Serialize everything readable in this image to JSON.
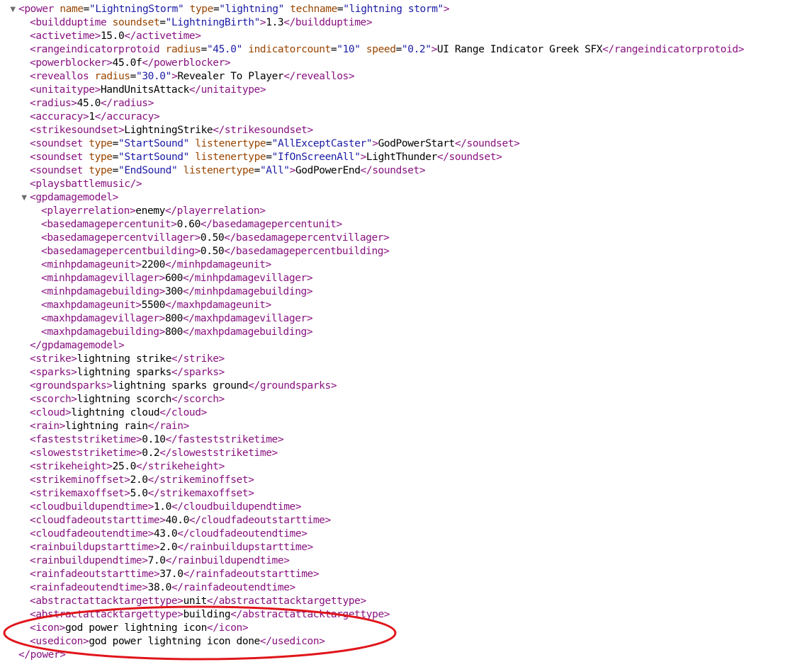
{
  "xml_lines": [
    {
      "depth": 0,
      "toggle": true,
      "segments": [
        [
          "tag",
          "<power"
        ],
        [
          "txt",
          " "
        ],
        [
          "attr",
          "name"
        ],
        [
          "txt",
          "="
        ],
        [
          "val",
          "\"LightningStorm\""
        ],
        [
          "txt",
          " "
        ],
        [
          "attr",
          "type"
        ],
        [
          "txt",
          "="
        ],
        [
          "val",
          "\"lightning\""
        ],
        [
          "txt",
          " "
        ],
        [
          "attr",
          "techname"
        ],
        [
          "txt",
          "="
        ],
        [
          "val",
          "\"lightning storm\""
        ],
        [
          "tag",
          ">"
        ]
      ]
    },
    {
      "depth": 1,
      "segments": [
        [
          "tag",
          "<buildduptime"
        ],
        [
          "txt",
          " "
        ],
        [
          "attr",
          "soundset"
        ],
        [
          "txt",
          "="
        ],
        [
          "val",
          "\"LightningBirth\""
        ],
        [
          "tag",
          ">"
        ],
        [
          "txt",
          "1.3"
        ],
        [
          "tag",
          "</buildduptime>"
        ]
      ]
    },
    {
      "depth": 1,
      "segments": [
        [
          "tag",
          "<activetime>"
        ],
        [
          "txt",
          "15.0"
        ],
        [
          "tag",
          "</activetime>"
        ]
      ]
    },
    {
      "depth": 1,
      "segments": [
        [
          "tag",
          "<rangeindicatorprotoid"
        ],
        [
          "txt",
          " "
        ],
        [
          "attr",
          "radius"
        ],
        [
          "txt",
          "="
        ],
        [
          "val",
          "\"45.0\""
        ],
        [
          "txt",
          " "
        ],
        [
          "attr",
          "indicatorcount"
        ],
        [
          "txt",
          "="
        ],
        [
          "val",
          "\"10\""
        ],
        [
          "txt",
          " "
        ],
        [
          "attr",
          "speed"
        ],
        [
          "txt",
          "="
        ],
        [
          "val",
          "\"0.2\""
        ],
        [
          "tag",
          ">"
        ],
        [
          "txt",
          "UI Range Indicator Greek SFX"
        ],
        [
          "tag",
          "</rangeindicatorprotoid>"
        ]
      ]
    },
    {
      "depth": 1,
      "segments": [
        [
          "tag",
          "<powerblocker>"
        ],
        [
          "txt",
          "45.0f"
        ],
        [
          "tag",
          "</powerblocker>"
        ]
      ]
    },
    {
      "depth": 1,
      "segments": [
        [
          "tag",
          "<reveallos"
        ],
        [
          "txt",
          " "
        ],
        [
          "attr",
          "radius"
        ],
        [
          "txt",
          "="
        ],
        [
          "val",
          "\"30.0\""
        ],
        [
          "tag",
          ">"
        ],
        [
          "txt",
          "Revealer To Player"
        ],
        [
          "tag",
          "</reveallos>"
        ]
      ]
    },
    {
      "depth": 1,
      "segments": [
        [
          "tag",
          "<unitaitype>"
        ],
        [
          "txt",
          "HandUnitsAttack"
        ],
        [
          "tag",
          "</unitaitype>"
        ]
      ]
    },
    {
      "depth": 1,
      "segments": [
        [
          "tag",
          "<radius>"
        ],
        [
          "txt",
          "45.0"
        ],
        [
          "tag",
          "</radius>"
        ]
      ]
    },
    {
      "depth": 1,
      "segments": [
        [
          "tag",
          "<accuracy>"
        ],
        [
          "txt",
          "1"
        ],
        [
          "tag",
          "</accuracy>"
        ]
      ]
    },
    {
      "depth": 1,
      "segments": [
        [
          "tag",
          "<strikesoundset>"
        ],
        [
          "txt",
          "LightningStrike"
        ],
        [
          "tag",
          "</strikesoundset>"
        ]
      ]
    },
    {
      "depth": 1,
      "segments": [
        [
          "tag",
          "<soundset"
        ],
        [
          "txt",
          " "
        ],
        [
          "attr",
          "type"
        ],
        [
          "txt",
          "="
        ],
        [
          "val",
          "\"StartSound\""
        ],
        [
          "txt",
          " "
        ],
        [
          "attr",
          "listenertype"
        ],
        [
          "txt",
          "="
        ],
        [
          "val",
          "\"AllExceptCaster\""
        ],
        [
          "tag",
          ">"
        ],
        [
          "txt",
          "GodPowerStart"
        ],
        [
          "tag",
          "</soundset>"
        ]
      ]
    },
    {
      "depth": 1,
      "segments": [
        [
          "tag",
          "<soundset"
        ],
        [
          "txt",
          " "
        ],
        [
          "attr",
          "type"
        ],
        [
          "txt",
          "="
        ],
        [
          "val",
          "\"StartSound\""
        ],
        [
          "txt",
          " "
        ],
        [
          "attr",
          "listenertype"
        ],
        [
          "txt",
          "="
        ],
        [
          "val",
          "\"IfOnScreenAll\""
        ],
        [
          "tag",
          ">"
        ],
        [
          "txt",
          "LightThunder"
        ],
        [
          "tag",
          "</soundset>"
        ]
      ]
    },
    {
      "depth": 1,
      "segments": [
        [
          "tag",
          "<soundset"
        ],
        [
          "txt",
          " "
        ],
        [
          "attr",
          "type"
        ],
        [
          "txt",
          "="
        ],
        [
          "val",
          "\"EndSound\""
        ],
        [
          "txt",
          " "
        ],
        [
          "attr",
          "listenertype"
        ],
        [
          "txt",
          "="
        ],
        [
          "val",
          "\"All\""
        ],
        [
          "tag",
          ">"
        ],
        [
          "txt",
          "GodPowerEnd"
        ],
        [
          "tag",
          "</soundset>"
        ]
      ]
    },
    {
      "depth": 1,
      "segments": [
        [
          "tag",
          "<playsbattlemusic/>"
        ]
      ]
    },
    {
      "depth": 1,
      "toggle": true,
      "segments": [
        [
          "tag",
          "<gpdamagemodel>"
        ]
      ]
    },
    {
      "depth": 2,
      "segments": [
        [
          "tag",
          "<playerrelation>"
        ],
        [
          "txt",
          "enemy"
        ],
        [
          "tag",
          "</playerrelation>"
        ]
      ]
    },
    {
      "depth": 2,
      "segments": [
        [
          "tag",
          "<basedamagepercentunit>"
        ],
        [
          "txt",
          "0.60"
        ],
        [
          "tag",
          "</basedamagepercentunit>"
        ]
      ]
    },
    {
      "depth": 2,
      "segments": [
        [
          "tag",
          "<basedamagepercentvillager>"
        ],
        [
          "txt",
          "0.50"
        ],
        [
          "tag",
          "</basedamagepercentvillager>"
        ]
      ]
    },
    {
      "depth": 2,
      "segments": [
        [
          "tag",
          "<basedamagepercentbuilding>"
        ],
        [
          "txt",
          "0.50"
        ],
        [
          "tag",
          "</basedamagepercentbuilding>"
        ]
      ]
    },
    {
      "depth": 2,
      "segments": [
        [
          "tag",
          "<minhpdamageunit>"
        ],
        [
          "txt",
          "2200"
        ],
        [
          "tag",
          "</minhpdamageunit>"
        ]
      ]
    },
    {
      "depth": 2,
      "segments": [
        [
          "tag",
          "<minhpdamagevillager>"
        ],
        [
          "txt",
          "600"
        ],
        [
          "tag",
          "</minhpdamagevillager>"
        ]
      ]
    },
    {
      "depth": 2,
      "segments": [
        [
          "tag",
          "<minhpdamagebuilding>"
        ],
        [
          "txt",
          "300"
        ],
        [
          "tag",
          "</minhpdamagebuilding>"
        ]
      ]
    },
    {
      "depth": 2,
      "segments": [
        [
          "tag",
          "<maxhpdamageunit>"
        ],
        [
          "txt",
          "5500"
        ],
        [
          "tag",
          "</maxhpdamageunit>"
        ]
      ]
    },
    {
      "depth": 2,
      "segments": [
        [
          "tag",
          "<maxhpdamagevillager>"
        ],
        [
          "txt",
          "800"
        ],
        [
          "tag",
          "</maxhpdamagevillager>"
        ]
      ]
    },
    {
      "depth": 2,
      "segments": [
        [
          "tag",
          "<maxhpdamagebuilding>"
        ],
        [
          "txt",
          "800"
        ],
        [
          "tag",
          "</maxhpdamagebuilding>"
        ]
      ]
    },
    {
      "depth": 1,
      "segments": [
        [
          "tag",
          "</gpdamagemodel>"
        ]
      ]
    },
    {
      "depth": 1,
      "segments": [
        [
          "tag",
          "<strike>"
        ],
        [
          "txt",
          "lightning strike"
        ],
        [
          "tag",
          "</strike>"
        ]
      ]
    },
    {
      "depth": 1,
      "segments": [
        [
          "tag",
          "<sparks>"
        ],
        [
          "txt",
          "lightning sparks"
        ],
        [
          "tag",
          "</sparks>"
        ]
      ]
    },
    {
      "depth": 1,
      "segments": [
        [
          "tag",
          "<groundsparks>"
        ],
        [
          "txt",
          "lightning sparks ground"
        ],
        [
          "tag",
          "</groundsparks>"
        ]
      ]
    },
    {
      "depth": 1,
      "segments": [
        [
          "tag",
          "<scorch>"
        ],
        [
          "txt",
          "lightning scorch"
        ],
        [
          "tag",
          "</scorch>"
        ]
      ]
    },
    {
      "depth": 1,
      "segments": [
        [
          "tag",
          "<cloud>"
        ],
        [
          "txt",
          "lightning cloud"
        ],
        [
          "tag",
          "</cloud>"
        ]
      ]
    },
    {
      "depth": 1,
      "segments": [
        [
          "tag",
          "<rain>"
        ],
        [
          "txt",
          "lightning rain"
        ],
        [
          "tag",
          "</rain>"
        ]
      ]
    },
    {
      "depth": 1,
      "segments": [
        [
          "tag",
          "<fasteststriketime>"
        ],
        [
          "txt",
          "0.10"
        ],
        [
          "tag",
          "</fasteststriketime>"
        ]
      ]
    },
    {
      "depth": 1,
      "segments": [
        [
          "tag",
          "<sloweststriketime>"
        ],
        [
          "txt",
          "0.2"
        ],
        [
          "tag",
          "</sloweststriketime>"
        ]
      ]
    },
    {
      "depth": 1,
      "segments": [
        [
          "tag",
          "<strikeheight>"
        ],
        [
          "txt",
          "25.0"
        ],
        [
          "tag",
          "</strikeheight>"
        ]
      ]
    },
    {
      "depth": 1,
      "segments": [
        [
          "tag",
          "<strikeminoffset>"
        ],
        [
          "txt",
          "2.0"
        ],
        [
          "tag",
          "</strikeminoffset>"
        ]
      ]
    },
    {
      "depth": 1,
      "segments": [
        [
          "tag",
          "<strikemaxoffset>"
        ],
        [
          "txt",
          "5.0"
        ],
        [
          "tag",
          "</strikemaxoffset>"
        ]
      ]
    },
    {
      "depth": 1,
      "segments": [
        [
          "tag",
          "<cloudbuildupendtime>"
        ],
        [
          "txt",
          "1.0"
        ],
        [
          "tag",
          "</cloudbuildupendtime>"
        ]
      ]
    },
    {
      "depth": 1,
      "segments": [
        [
          "tag",
          "<cloudfadeoutstarttime>"
        ],
        [
          "txt",
          "40.0"
        ],
        [
          "tag",
          "</cloudfadeoutstarttime>"
        ]
      ]
    },
    {
      "depth": 1,
      "segments": [
        [
          "tag",
          "<cloudfadeoutendtime>"
        ],
        [
          "txt",
          "43.0"
        ],
        [
          "tag",
          "</cloudfadeoutendtime>"
        ]
      ]
    },
    {
      "depth": 1,
      "segments": [
        [
          "tag",
          "<rainbuildupstarttime>"
        ],
        [
          "txt",
          "2.0"
        ],
        [
          "tag",
          "</rainbuildupstarttime>"
        ]
      ]
    },
    {
      "depth": 1,
      "segments": [
        [
          "tag",
          "<rainbuildupendtime>"
        ],
        [
          "txt",
          "7.0"
        ],
        [
          "tag",
          "</rainbuildupendtime>"
        ]
      ]
    },
    {
      "depth": 1,
      "segments": [
        [
          "tag",
          "<rainfadeoutstarttime>"
        ],
        [
          "txt",
          "37.0"
        ],
        [
          "tag",
          "</rainfadeoutstarttime>"
        ]
      ]
    },
    {
      "depth": 1,
      "segments": [
        [
          "tag",
          "<rainfadeoutendtime>"
        ],
        [
          "txt",
          "38.0"
        ],
        [
          "tag",
          "</rainfadeoutendtime>"
        ]
      ]
    },
    {
      "depth": 1,
      "segments": [
        [
          "tag",
          "<abstractattacktargettype>"
        ],
        [
          "txt",
          "unit"
        ],
        [
          "tag",
          "</abstractattacktargettype>"
        ]
      ]
    },
    {
      "depth": 1,
      "segments": [
        [
          "tag",
          "<abstractattacktargettype>"
        ],
        [
          "txt",
          "building"
        ],
        [
          "tag",
          "</abstractattacktargettype>"
        ]
      ]
    },
    {
      "depth": 1,
      "segments": [
        [
          "tag",
          "<icon>"
        ],
        [
          "txt",
          "god power lightning icon"
        ],
        [
          "tag",
          "</icon>"
        ]
      ]
    },
    {
      "depth": 1,
      "segments": [
        [
          "tag",
          "<usedicon>"
        ],
        [
          "txt",
          "god power lightning icon done"
        ],
        [
          "tag",
          "</usedicon>"
        ]
      ]
    },
    {
      "depth": 0,
      "segments": [
        [
          "tag",
          "</power>"
        ]
      ]
    }
  ],
  "icons": {
    "expand": "triangle-down-icon"
  },
  "toggle_glyph": "▼",
  "colors": {
    "tag": "#881280",
    "attribute_name": "#994500",
    "attribute_value": "#1a1aa6",
    "text": "#000000",
    "highlight": "#e0151b"
  }
}
